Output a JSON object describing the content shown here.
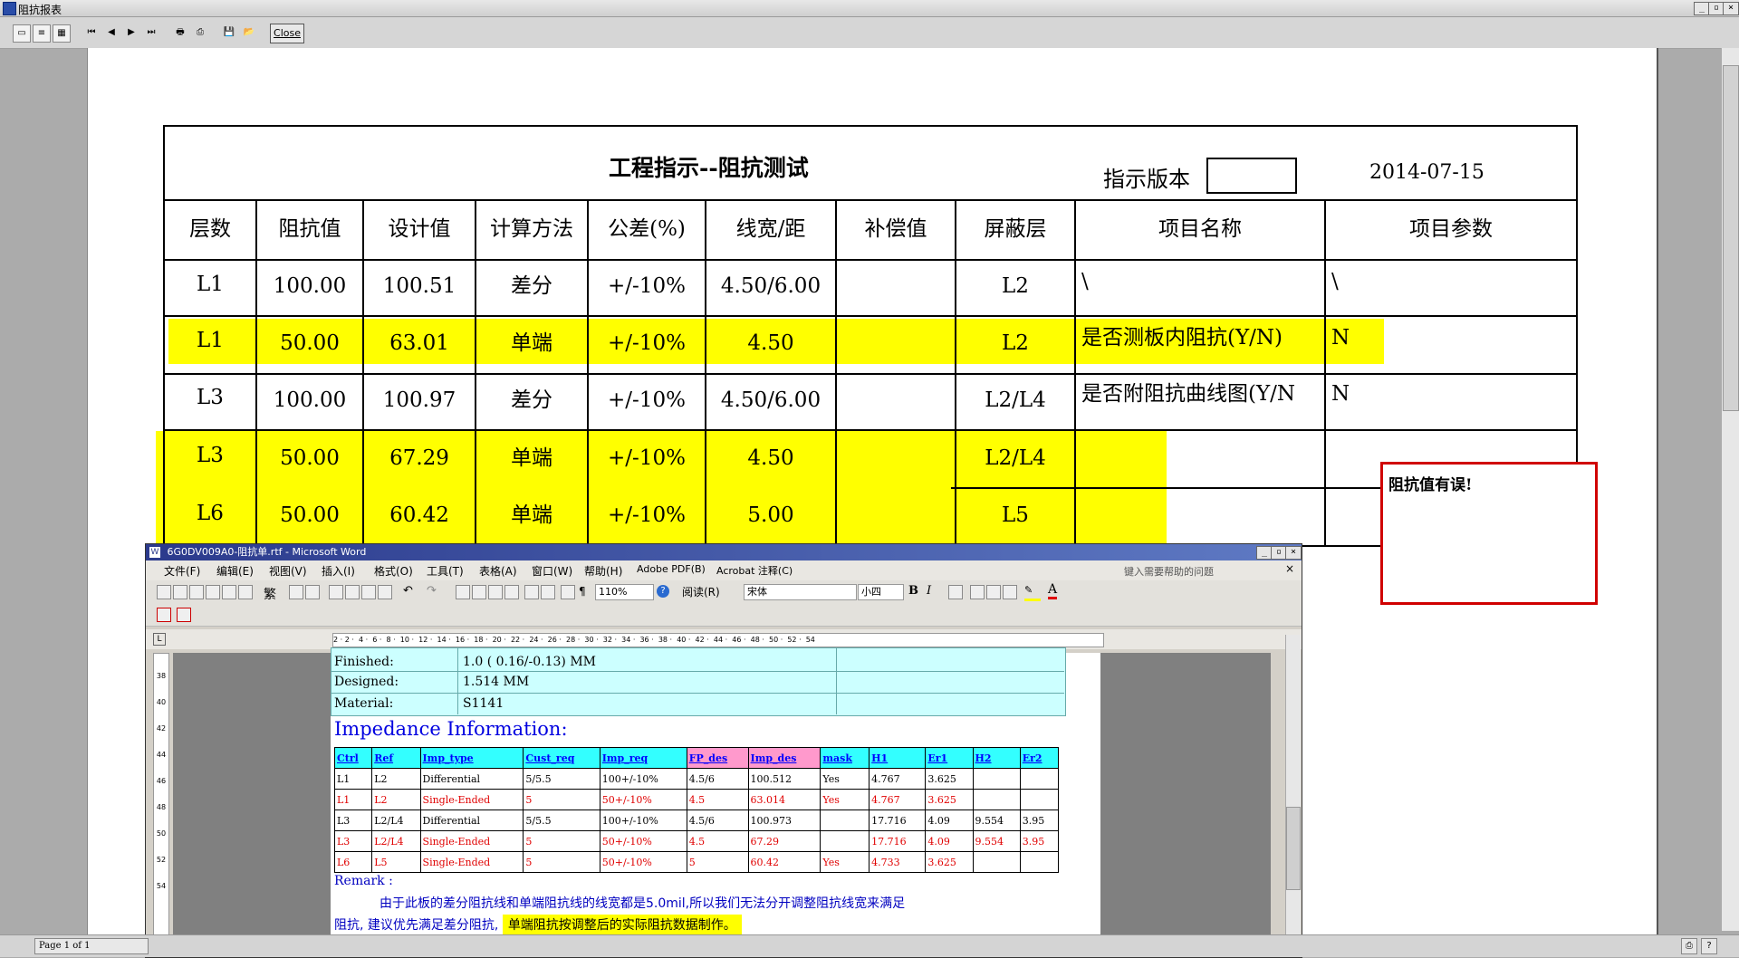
{
  "window": {
    "title": "阻抗报表",
    "toolbar": {
      "close_label": "Close"
    },
    "status": {
      "page_info": "Page 1 of 1"
    }
  },
  "report": {
    "title": "工程指示--阻抗测试",
    "version_label": "指示版本",
    "version_value": "",
    "date": "2014-07-15",
    "headers": [
      "层数",
      "阻抗值",
      "设计值",
      "计算方法",
      "公差(%)",
      "线宽/距",
      "补偿值",
      "屏蔽层",
      "项目名称",
      "项目参数"
    ],
    "rows": [
      {
        "layer": "L1",
        "imp": "100.00",
        "design": "100.51",
        "method": "差分",
        "tol": "+/-10%",
        "width": "4.50/6.00",
        "comp": "",
        "shield": "L2",
        "item_name": "\\",
        "item_param": "\\"
      },
      {
        "layer": "L1",
        "imp": "50.00",
        "design": "63.01",
        "method": "单端",
        "tol": "+/-10%",
        "width": "4.50",
        "comp": "",
        "shield": "L2",
        "item_name": "是否测板内阻抗(Y/N)",
        "item_param": "N"
      },
      {
        "layer": "L3",
        "imp": "100.00",
        "design": "100.97",
        "method": "差分",
        "tol": "+/-10%",
        "width": "4.50/6.00",
        "comp": "",
        "shield": "L2/L4",
        "item_name": "是否附阻抗曲线图(Y/N",
        "item_param": "N"
      },
      {
        "layer": "L3",
        "imp": "50.00",
        "design": "67.29",
        "method": "单端",
        "tol": "+/-10%",
        "width": "4.50",
        "comp": "",
        "shield": "L2/L4",
        "item_name": "",
        "item_param": ""
      },
      {
        "layer": "L6",
        "imp": "50.00",
        "design": "60.42",
        "method": "单端",
        "tol": "+/-10%",
        "width": "5.00",
        "comp": "",
        "shield": "L5",
        "item_name": "",
        "item_param": ""
      }
    ],
    "highlight_color": "#ffff00",
    "error_note": "阻抗值有误!",
    "error_border_color": "#d00000"
  },
  "word": {
    "title": "6G0DV009A0-阻抗单.rtf - Microsoft Word",
    "menus": [
      "文件(F)",
      "编辑(E)",
      "视图(V)",
      "插入(I)",
      "格式(O)",
      "工具(T)",
      "表格(A)",
      "窗口(W)",
      "帮助(H)",
      "Adobe PDF(B)",
      "Acrobat 注释(C)"
    ],
    "help_placeholder": "键入需要帮助的问题",
    "zoom": "110%",
    "read_label": "阅读(R)",
    "font_name": "宋体",
    "font_size": "小四",
    "ruler_marks": [
      "2",
      "2",
      "4",
      "6",
      "8",
      "10",
      "12",
      "14",
      "16",
      "18",
      "20",
      "22",
      "24",
      "26",
      "28",
      "30",
      "32",
      "34",
      "36",
      "38",
      "40",
      "42",
      "44",
      "46",
      "48",
      "50",
      "52",
      "54"
    ],
    "info_rows": [
      {
        "label": "Finished:",
        "value": "1.0 ( 0.16/-0.13) MM"
      },
      {
        "label": "Designed:",
        "value": "1.514 MM"
      },
      {
        "label": "Material:",
        "value": "S1141"
      }
    ],
    "section_title": "Impedance Information:",
    "imp_headers": [
      "Ctrl",
      "Ref",
      "Imp_type",
      "Cust_req",
      "Imp_req",
      "FP_des",
      "Imp_des",
      "mask",
      "H1",
      "Er1",
      "H2",
      "Er2"
    ],
    "imp_rows": [
      {
        "cells": [
          "L1",
          "L2",
          "Differential",
          "5/5.5",
          "100+/-10%",
          "4.5/6",
          "100.512",
          "Yes",
          "4.767",
          "3.625",
          "",
          ""
        ],
        "red": false
      },
      {
        "cells": [
          "L1",
          "L2",
          "Single-Ended",
          "5",
          "50+/-10%",
          "4.5",
          "63.014",
          "Yes",
          "4.767",
          "3.625",
          "",
          ""
        ],
        "red": true
      },
      {
        "cells": [
          "L3",
          "L2/L4",
          "Differential",
          "5/5.5",
          "100+/-10%",
          "4.5/6",
          "100.973",
          "",
          "17.716",
          "4.09",
          "9.554",
          "3.95"
        ],
        "red": false
      },
      {
        "cells": [
          "L3",
          "L2/L4",
          "Single-Ended",
          "5",
          "50+/-10%",
          "4.5",
          "67.29",
          "",
          "17.716",
          "4.09",
          "9.554",
          "3.95"
        ],
        "red": true
      },
      {
        "cells": [
          "L6",
          "L5",
          "Single-Ended",
          "5",
          "50+/-10%",
          "5",
          "60.42",
          "Yes",
          "4.733",
          "3.625",
          "",
          ""
        ],
        "red": true
      }
    ],
    "remark_label": "Remark :",
    "remark_line1": "由于此板的差分阻抗线和单端阻抗线的线宽都是5.0mil,所以我们无法分开调整阻抗线宽来满足",
    "remark_line2a": "阻抗, 建议优先满足差分阻抗,",
    "remark_line2b": "单端阻抗按调整后的实际阻抗数据制作。",
    "ruler_v_marks": [
      "38",
      "40",
      "42",
      "44",
      "46",
      "48",
      "50",
      "52",
      "54"
    ]
  }
}
